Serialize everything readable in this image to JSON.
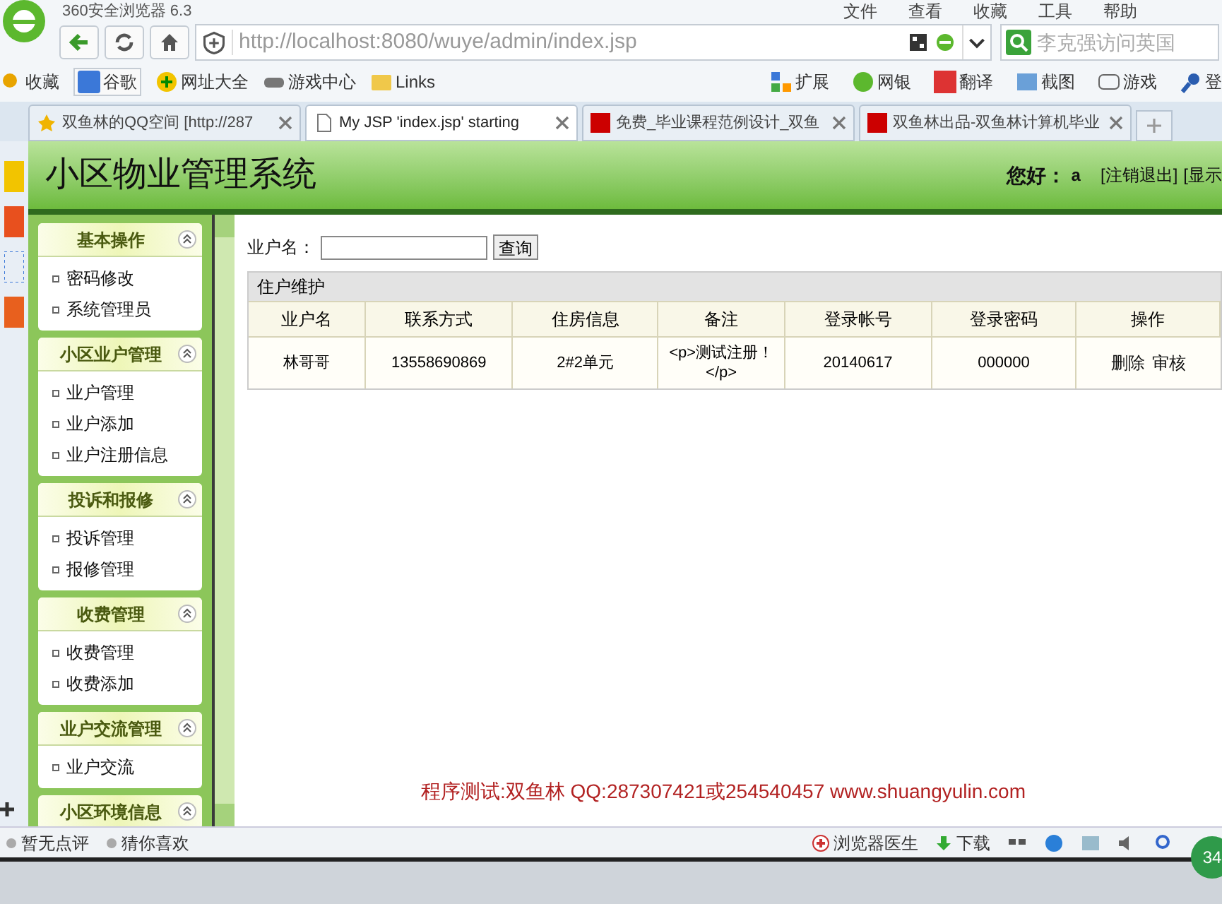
{
  "browser": {
    "title": "360安全浏览器 6.3",
    "menu": [
      "文件",
      "查看",
      "收藏",
      "工具",
      "帮助"
    ],
    "address": "http://localhost:8080/wuye/admin/index.jsp",
    "search_placeholder": "李克强访问英国",
    "bookmarks": [
      "收藏",
      "谷歌",
      "网址大全",
      "游戏中心",
      "Links"
    ],
    "tools": [
      "扩展",
      "网银",
      "翻译",
      "截图",
      "游戏",
      "登"
    ],
    "tabs": [
      {
        "label": "双鱼林的QQ空间 [http://287",
        "selected": false
      },
      {
        "label": "My JSP 'index.jsp' starting",
        "selected": true
      },
      {
        "label": "免费_毕业课程范例设计_双鱼",
        "selected": false
      },
      {
        "label": "双鱼林出品-双鱼林计算机毕业",
        "selected": false
      }
    ],
    "status_left": [
      "暂无点评",
      "猜你喜欢"
    ],
    "status_right": [
      "浏览器医生",
      "下载"
    ],
    "badge": "34"
  },
  "app": {
    "title": "小区物业管理系统",
    "greeting": "您好：",
    "user": "a",
    "links": [
      "[注销退出]",
      "[显示"
    ],
    "sidebar": [
      {
        "title": "基本操作",
        "expanded": true,
        "items": [
          "密码修改",
          "系统管理员"
        ]
      },
      {
        "title": "小区业户管理",
        "expanded": true,
        "items": [
          "业户管理",
          "业户添加",
          "业户注册信息"
        ]
      },
      {
        "title": "投诉和报修",
        "expanded": true,
        "items": [
          "投诉管理",
          "报修管理"
        ]
      },
      {
        "title": "收费管理",
        "expanded": true,
        "items": [
          "收费管理",
          "收费添加"
        ]
      },
      {
        "title": "业户交流管理",
        "expanded": true,
        "items": [
          "业户交流"
        ]
      },
      {
        "title": "小区环境信息",
        "expanded": true
      }
    ],
    "search": {
      "label": "业户名：",
      "button": "查询"
    },
    "table": {
      "caption": "住户维护",
      "columns": [
        "业户名",
        "联系方式",
        "住房信息",
        "备注",
        "登录帐号",
        "登录密码",
        "操作"
      ],
      "rows": [
        {
          "cells": [
            "林哥哥",
            "13558690869",
            "2#2单元",
            "<p>测试注册！</p>",
            "20140617",
            "000000"
          ],
          "actions": [
            "删除",
            "审核"
          ]
        }
      ]
    },
    "footer": "程序测试:双鱼林 QQ:287307421或254540457 www.shuangyulin.com"
  }
}
